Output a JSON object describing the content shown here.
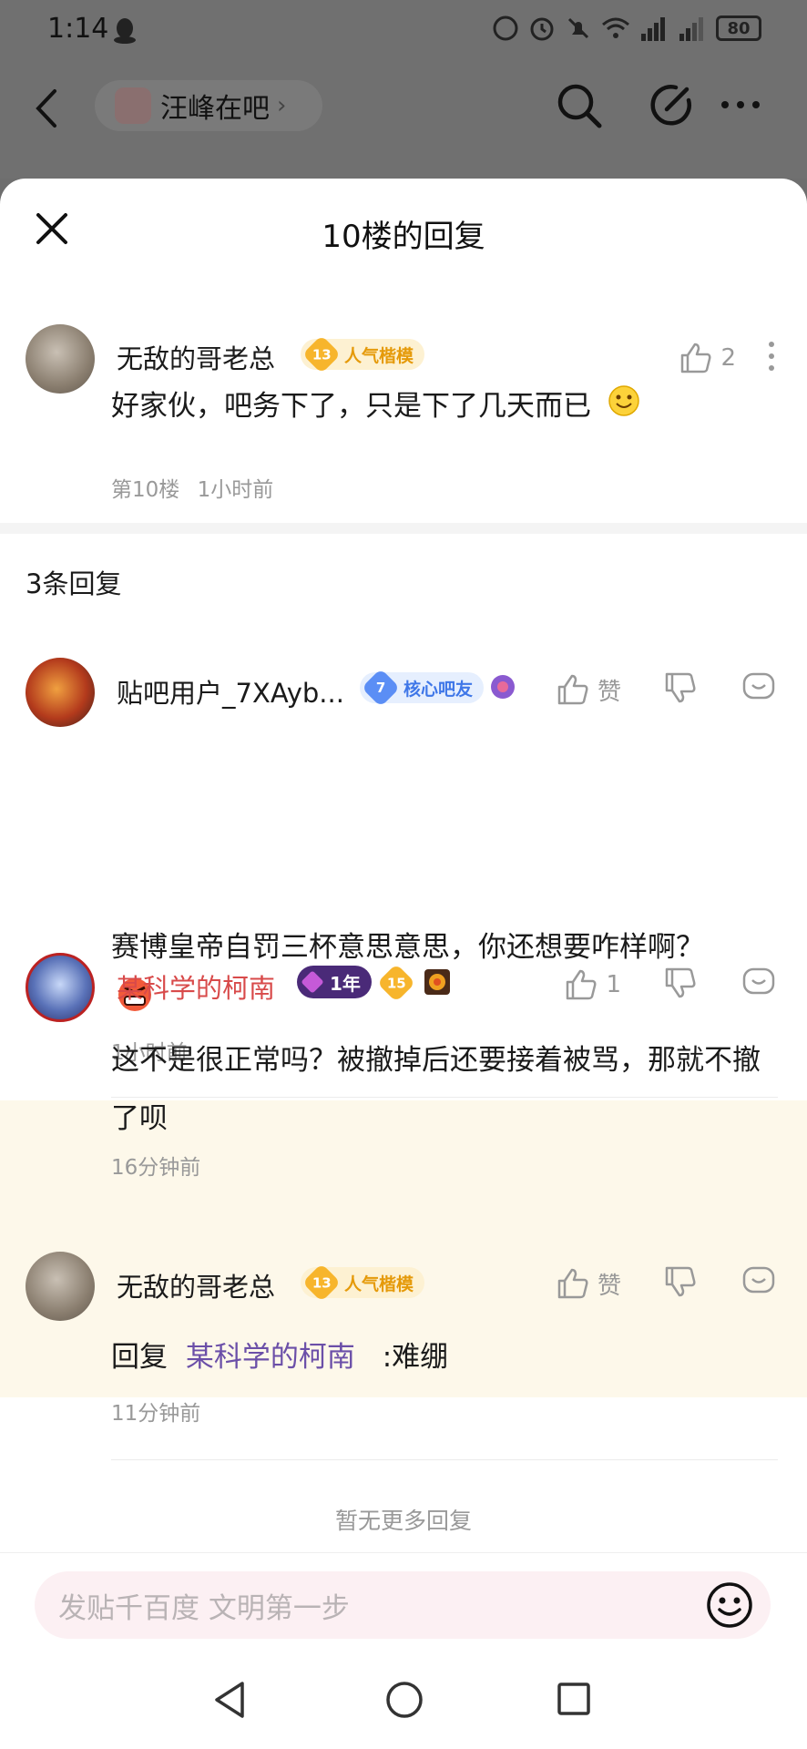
{
  "status_bar": {
    "time": "1:14",
    "battery": "80",
    "network_1": "4G",
    "network_2": "4G"
  },
  "nav": {
    "forum_name": "汪峰在吧"
  },
  "sheet": {
    "title": "10楼的回复"
  },
  "main_post": {
    "username": "无敌的哥老总",
    "level": "13",
    "badge": "人气楷模",
    "likes": "2",
    "text": "好家伙，吧务下了，只是下了几天而已",
    "floor": "第10楼",
    "time": "1小时前"
  },
  "reply_count_label": "3条回复",
  "replies": [
    {
      "username": "贴吧用户_7XAyb...",
      "level": "7",
      "badge": "核心吧友",
      "like_label": "赞",
      "text": "赛博皇帝自罚三杯意思意思，你还想要咋样啊？",
      "time": "1小时前"
    },
    {
      "username": "某科学的柯南",
      "tenure": "1年",
      "level": "15",
      "like_label": "1",
      "text": "这不是很正常吗？被撤掉后还要接着被骂，那就不撤了呗",
      "time": "16分钟前"
    },
    {
      "username": "无敌的哥老总",
      "level": "13",
      "badge": "人气楷模",
      "like_label": "赞",
      "reply_prefix": "回复",
      "reply_to": "某科学的柯南",
      "text": ":难绷",
      "time": "11分钟前"
    }
  ],
  "no_more": "暂无更多回复",
  "reply_input": {
    "placeholder": "发贴千百度 文明第一步"
  },
  "colors": {
    "accent_red": "#d84a4a",
    "link_purple": "#6b4fa8",
    "gold": "#f7b52c",
    "blue": "#5b8ef5",
    "highlight_bg": "#fdf8ea"
  }
}
